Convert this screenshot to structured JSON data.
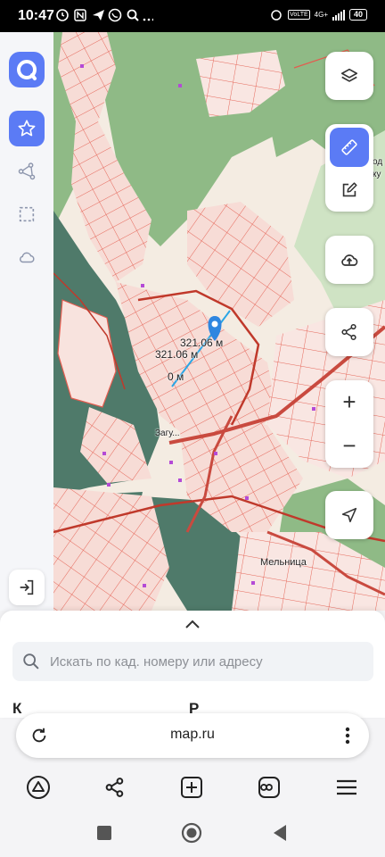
{
  "status_bar": {
    "time": "10:47",
    "network": "4G+",
    "volte": "VoLTE",
    "battery": "40"
  },
  "sidebar": {
    "items": [
      {
        "name": "app-logo",
        "icon": "app-logo-icon"
      },
      {
        "name": "favorites",
        "icon": "star-icon",
        "active": true
      },
      {
        "name": "measure-polyline",
        "icon": "polyline-icon"
      },
      {
        "name": "select-area",
        "icon": "dashed-square-icon"
      },
      {
        "name": "cloud",
        "icon": "cloud-icon"
      },
      {
        "name": "login",
        "icon": "login-icon"
      }
    ]
  },
  "map": {
    "distance_label_main": "321.06 м",
    "distance_label_secondary": "321.06 м",
    "distance_label_start": "0 м",
    "place_label": "Мельница",
    "street_label": "Загу...",
    "edge_label_1": "од",
    "edge_label_2": "ку"
  },
  "map_controls": {
    "zoom_in": "+",
    "zoom_out": "−"
  },
  "sheet": {
    "search_placeholder": "Искать по кад. номеру или адресу",
    "partial_text_1": "К",
    "partial_text_2": "Р"
  },
  "browser": {
    "url": "map.ru"
  },
  "colors": {
    "accent": "#5b7bf5",
    "forest": "#8fba86",
    "water": "#4f7a6a",
    "parcel_fill": "#f6dcd7",
    "parcel_line": "#e35c4f",
    "road": "#c94a3f"
  }
}
